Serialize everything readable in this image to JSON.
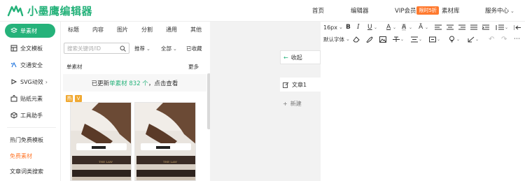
{
  "app": {
    "logo_text": "小墨鹰编辑器",
    "accent_color": "#25b27a",
    "nav": {
      "home": "首页",
      "editor": "编辑器",
      "vip": "VIP会员",
      "vip_badge": "限时5折",
      "library": "素材库",
      "service": "服务中心"
    }
  },
  "sidebar": {
    "active": {
      "label": "单素材",
      "icon": "layers-icon"
    },
    "items": [
      {
        "label": "全文模板",
        "icon": "template-icon"
      },
      {
        "label": "交通安全",
        "icon": "traffic-icon"
      },
      {
        "label": "SVG动效",
        "icon": "svg-icon",
        "has_arrow": true
      },
      {
        "label": "贴纸元素",
        "icon": "puzzle-icon"
      },
      {
        "label": "工具助手",
        "icon": "box-icon"
      }
    ],
    "links": [
      {
        "label": "热门免费模板",
        "color": "#333333"
      },
      {
        "label": "免费素材",
        "color": "#ff7a2f"
      },
      {
        "label": "文章词类搜索",
        "color": "#333333"
      }
    ]
  },
  "panel": {
    "tabs": [
      "标题",
      "内容",
      "图片",
      "分割",
      "通用",
      "其他"
    ],
    "search_placeholder": "搜索关键词/ID",
    "filters": {
      "sort": "推荐",
      "scope": "全部",
      "favorites": "已收藏"
    },
    "list_title": "单素材",
    "list_more": "更多",
    "update_notice": {
      "prefix": "已更新",
      "highlight": "单素材 832 个",
      "suffix": "，点击查看"
    },
    "badges": [
      "热",
      "V"
    ]
  },
  "editor": {
    "side_buttons": {
      "collapse": "收起",
      "article": "文章1",
      "add": "新建"
    },
    "toolbar": {
      "font_size": "16px",
      "font_family": "默认字体"
    }
  }
}
